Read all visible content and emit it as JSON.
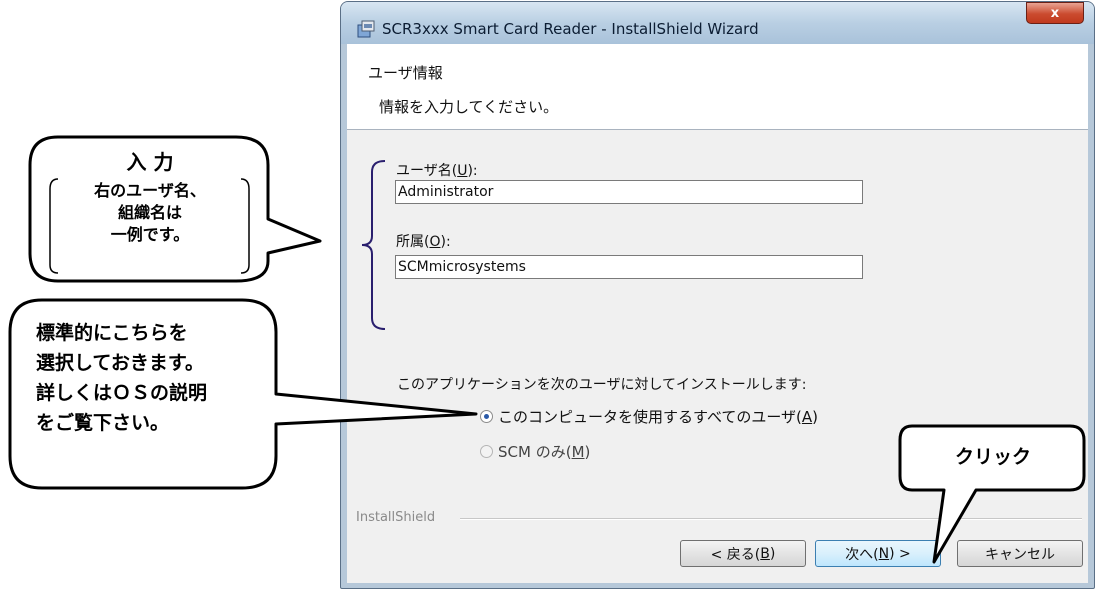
{
  "window": {
    "title": "SCR3xxx Smart Card Reader - InstallShield Wizard",
    "close_glyph": "x"
  },
  "header": {
    "title": "ユーザ情報",
    "subtitle": "情報を入力してください。"
  },
  "form": {
    "user_label_pre": "ユーザ名(",
    "user_label_key": "U",
    "user_label_post": "):",
    "user_value": "Administrator",
    "org_label_pre": "所属(",
    "org_label_key": "O",
    "org_label_post": "):",
    "org_value": "SCMmicrosystems",
    "install_for_label": "このアプリケーションを次のユーザに対してインストールします:",
    "option_all_pre": "このコンピュータを使用するすべてのユーザ(",
    "option_all_key": "A",
    "option_all_post": ")",
    "option_only_pre": "SCM のみ(",
    "option_only_key": "M",
    "option_only_post": ")",
    "selected_option": "all"
  },
  "footer": {
    "installshield_label": "InstallShield",
    "back_pre": "< 戻る(",
    "back_key": "B",
    "back_post": ")",
    "next_pre": "次へ(",
    "next_key": "N",
    "next_post": ") >",
    "cancel_label": "キャンセル"
  },
  "annotations": {
    "input_callout": {
      "line1": "入 力",
      "line2": "右のユーザ名、",
      "line3": "組織名は",
      "line4": "一例です。"
    },
    "select_callout": {
      "line1": "標準的にこちらを",
      "line2": "選択しておきます。",
      "line3": "詳しくはＯＳの説明",
      "line4": "をご覧下さい。"
    },
    "click_callout": {
      "text": "クリック"
    }
  },
  "colors": {
    "titlebar": "#b9cfe3",
    "close_button": "#c7432a",
    "bracket": "#2a1f6e",
    "radio_selected": "#2b5aa8"
  }
}
